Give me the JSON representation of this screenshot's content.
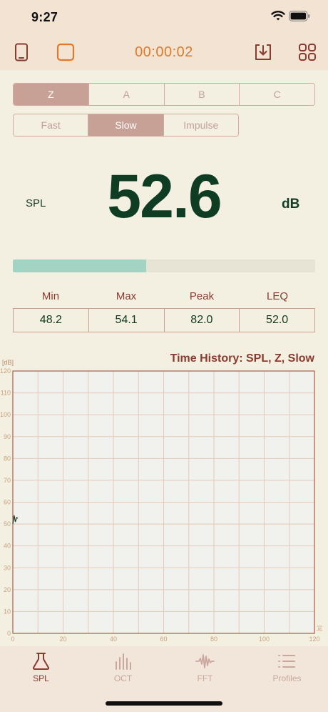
{
  "status_bar": {
    "time": "9:27"
  },
  "toolbar": {
    "timer": "00:00:02",
    "icons": [
      "phone-icon",
      "stop-icon",
      "download-icon",
      "apps-grid-icon"
    ]
  },
  "weighting": {
    "options": [
      "Z",
      "A",
      "B",
      "C"
    ],
    "selected": "Z"
  },
  "response": {
    "options": [
      "Fast",
      "Slow",
      "Impulse"
    ],
    "selected": "Slow"
  },
  "measurement": {
    "label": "SPL",
    "value": "52.6",
    "unit": "dB",
    "level_fraction": 0.44
  },
  "stats": {
    "labels": [
      "Min",
      "Max",
      "Peak",
      "LEQ"
    ],
    "values": [
      "48.2",
      "54.1",
      "82.0",
      "52.0"
    ]
  },
  "colors": {
    "accent_orange": "#e07a28",
    "brick": "#8a3a2e",
    "dark_green": "#0f3d24",
    "meter_fill": "#a3d3c2",
    "segment_active": "#c7a096"
  },
  "chart_data": {
    "type": "line",
    "title": "Time History: SPL, Z, Slow",
    "ylabel": "[dB]",
    "xlabel": "[s]",
    "xlim": [
      0,
      120
    ],
    "ylim": [
      0,
      120
    ],
    "x_ticks": [
      "0",
      "20",
      "40",
      "60",
      "80",
      "100",
      "120"
    ],
    "y_ticks": [
      "0",
      "10",
      "20",
      "30",
      "40",
      "50",
      "60",
      "70",
      "80",
      "90",
      "100",
      "110",
      "120"
    ],
    "grid": true,
    "series": [
      {
        "x": [
          0,
          0.5,
          1,
          1.5,
          2
        ],
        "y": [
          50,
          54,
          51,
          53,
          52.6
        ]
      }
    ]
  },
  "tabs": [
    {
      "label": "SPL",
      "icon": "flask-icon",
      "active": true
    },
    {
      "label": "OCT",
      "icon": "octave-bars-icon",
      "active": false
    },
    {
      "label": "FFT",
      "icon": "waveform-icon",
      "active": false
    },
    {
      "label": "Profiles",
      "icon": "list-icon",
      "active": false
    }
  ]
}
